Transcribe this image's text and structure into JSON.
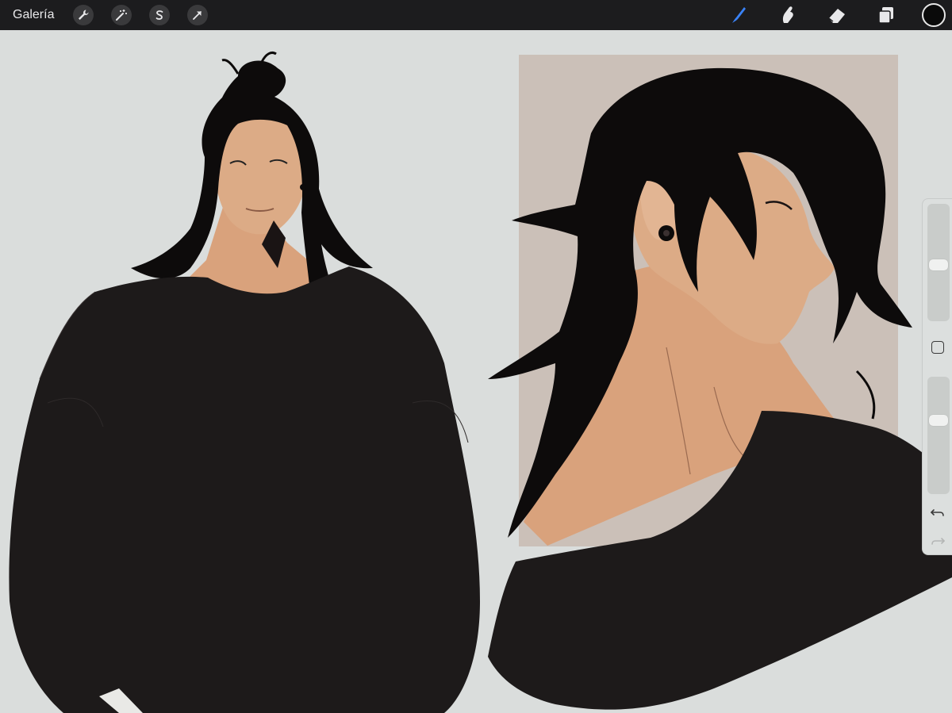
{
  "toolbar": {
    "gallery_label": "Galería",
    "left_tools": [
      {
        "name": "actions",
        "icon": "wrench-icon"
      },
      {
        "name": "adjustments",
        "icon": "magic-wand-icon"
      },
      {
        "name": "selection",
        "icon": "selection-s-icon"
      },
      {
        "name": "transform",
        "icon": "arrow-cursor-icon"
      }
    ],
    "right_tools": [
      {
        "name": "brush",
        "icon": "brush-icon",
        "active": true
      },
      {
        "name": "smudge",
        "icon": "smudge-finger-icon"
      },
      {
        "name": "eraser",
        "icon": "eraser-icon"
      },
      {
        "name": "layers",
        "icon": "layers-icon"
      }
    ],
    "current_color": "#0a0a0a",
    "accent_color": "#3a82f6"
  },
  "sidebar": {
    "brush_size_level": 0.42,
    "opacity_level": 0.63,
    "modify_icon": "square-modify-icon",
    "undo_icon": "undo-icon",
    "redo_icon": "redo-icon"
  },
  "canvas": {
    "background": "#dadddc",
    "panel_color": "#cbc0b8",
    "skin_color": "#d9a27c",
    "hair_color": "#0d0b0b",
    "sweater_color": "#1d1a1a"
  }
}
